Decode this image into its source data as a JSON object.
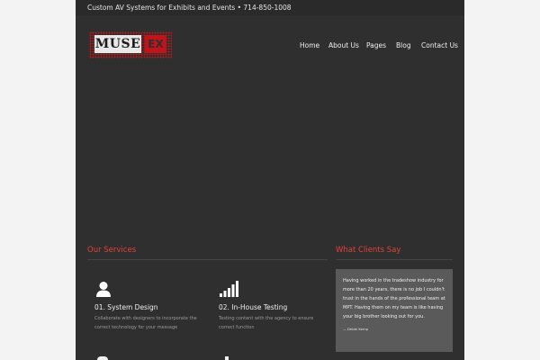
{
  "topbar": {
    "text": "Custom AV Systems for Exhibits and Events • 714-850-1008"
  },
  "logo": {
    "word": "MUSE",
    "mark": "EX"
  },
  "nav": {
    "items": [
      {
        "label": "Home"
      },
      {
        "label": "About Us"
      },
      {
        "label": "Pages"
      },
      {
        "label": "Blog"
      },
      {
        "label": "Contact Us"
      }
    ]
  },
  "services": {
    "title": "Our Services",
    "items": [
      {
        "title": "01. System Design",
        "text": "Collaborate with designers to incorporate the correct technology for your message",
        "icon": "user-icon"
      },
      {
        "title": "02. In-House Testing",
        "text": "Testing content with the agency to ensure correct function",
        "icon": "signal-bars-icon"
      }
    ]
  },
  "testimonials": {
    "title": "What Clients Say",
    "quote": "Having worked in the tradeshow industry for more than 20 years, there is no job I couldn't trust in the hands of the professional team at MPT. Having them on my team is like having your big brother looking out for you.",
    "author": "— Debbi Kemp"
  },
  "colors": {
    "accent": "#e2423a",
    "panel": "#2f2f2f",
    "logo_red": "#c0141a"
  }
}
